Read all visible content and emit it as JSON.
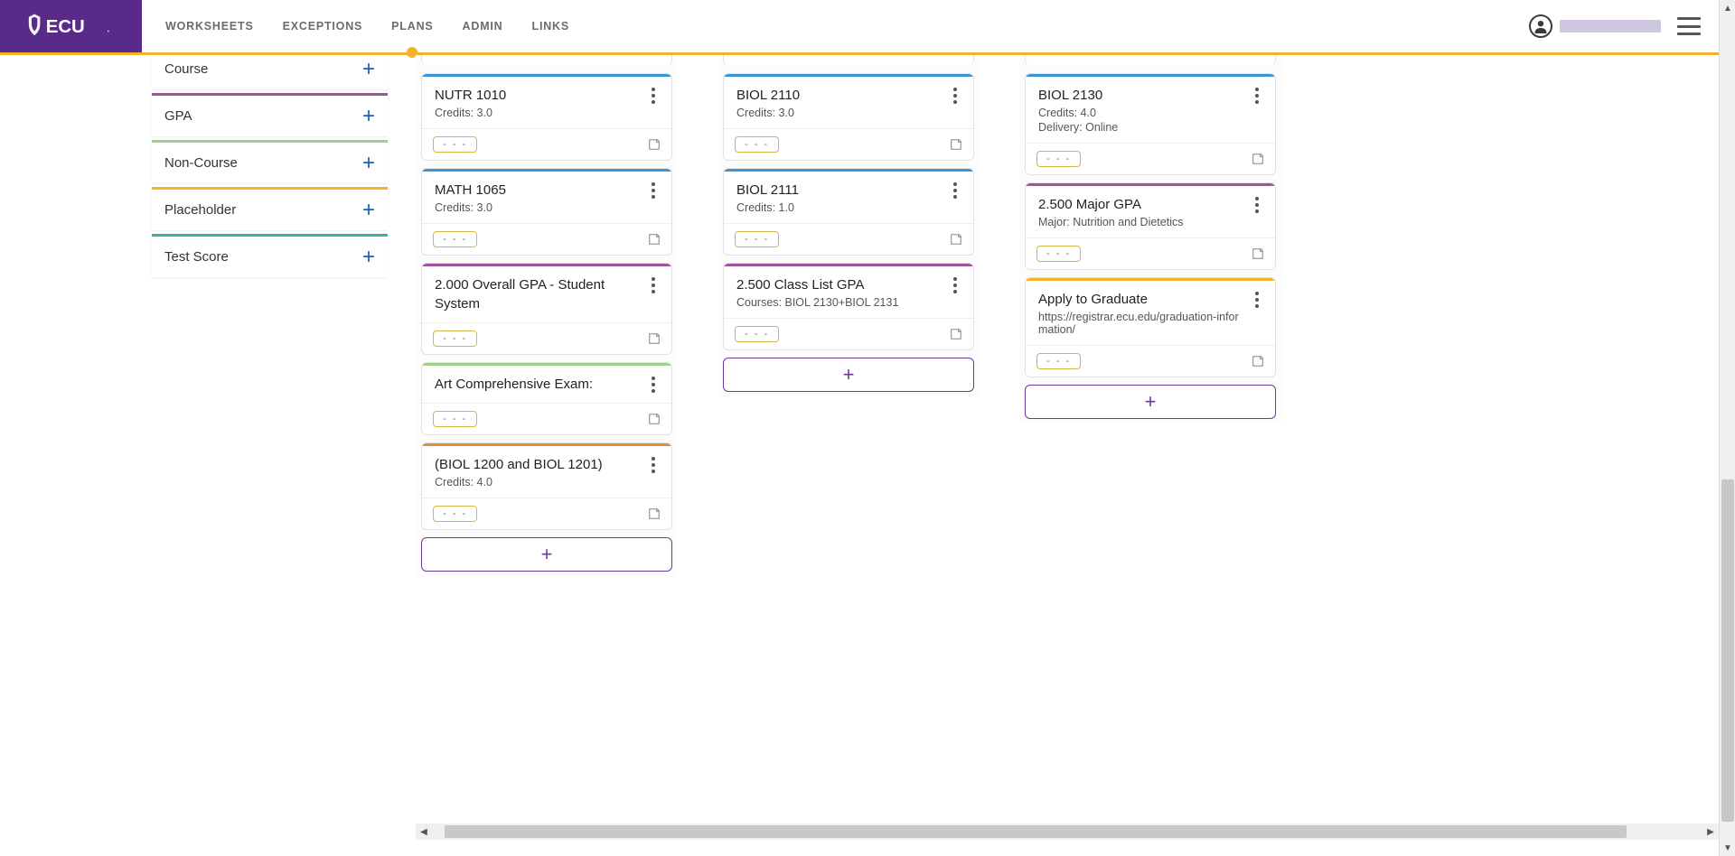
{
  "brand": {
    "name": "ECU"
  },
  "nav": {
    "worksheets": "WORKSHEETS",
    "exceptions": "EXCEPTIONS",
    "plans": "PLANS",
    "admin": "ADMIN",
    "links": "LINKS"
  },
  "sidebar": {
    "course": "Course",
    "gpa": "GPA",
    "noncourse": "Non-Course",
    "placeholder": "Placeholder",
    "testscore": "Test Score",
    "plus": "+"
  },
  "pill": "- - -",
  "add": "+",
  "col1": {
    "c1": {
      "title": "NUTR 1010",
      "sub": "Credits: 3.0"
    },
    "c2": {
      "title": "MATH 1065",
      "sub": "Credits: 3.0"
    },
    "c3": {
      "title": "2.000 Overall GPA - Student System"
    },
    "c4": {
      "title": "Art Comprehensive Exam:"
    },
    "c5": {
      "title": "(BIOL 1200 and BIOL 1201)",
      "sub": "Credits: 4.0"
    }
  },
  "col2": {
    "c1": {
      "title": "BIOL 2110",
      "sub": "Credits: 3.0"
    },
    "c2": {
      "title": "BIOL 2111",
      "sub": "Credits: 1.0"
    },
    "c3": {
      "title": "2.500 Class List GPA",
      "sub": "Courses: BIOL 2130+BIOL 2131"
    }
  },
  "col3": {
    "c1": {
      "title": "BIOL 2130",
      "sub1": "Credits: 4.0",
      "sub2": "Delivery: Online"
    },
    "c2": {
      "title": "2.500 Major GPA",
      "sub": "Major: Nutrition and Dietetics"
    },
    "c3": {
      "title": "Apply to Graduate",
      "sub": "https://registrar.ecu.edu/graduation-information/"
    }
  }
}
